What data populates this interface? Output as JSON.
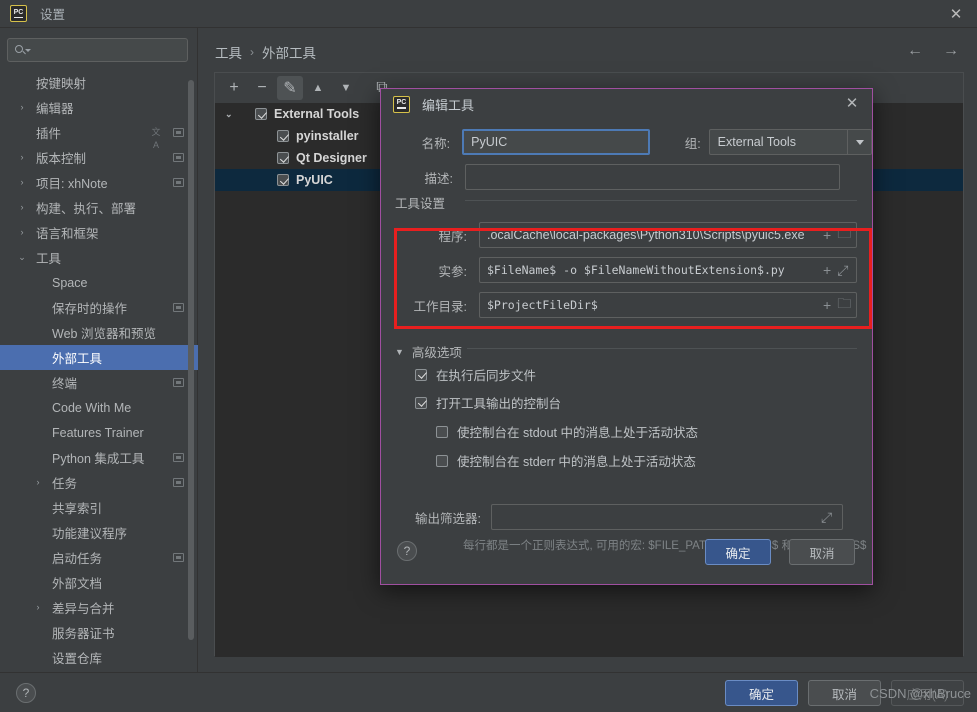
{
  "window": {
    "title": "设置",
    "logo_text": "PC",
    "close_icon": "✕"
  },
  "sidebar": {
    "search_placeholder": "",
    "items": [
      {
        "label": "按键映射",
        "indent": 36,
        "arrow": "",
        "mark": false,
        "tr": false,
        "selected": false
      },
      {
        "label": "编辑器",
        "indent": 36,
        "arrow": "›",
        "mark": false,
        "tr": false,
        "selected": false
      },
      {
        "label": "插件",
        "indent": 36,
        "arrow": "",
        "mark": true,
        "tr": true,
        "selected": false
      },
      {
        "label": "版本控制",
        "indent": 36,
        "arrow": "›",
        "mark": true,
        "tr": false,
        "selected": false
      },
      {
        "label": "项目: xhNote",
        "indent": 36,
        "arrow": "›",
        "mark": true,
        "tr": false,
        "selected": false
      },
      {
        "label": "构建、执行、部署",
        "indent": 36,
        "arrow": "›",
        "mark": false,
        "tr": false,
        "selected": false
      },
      {
        "label": "语言和框架",
        "indent": 36,
        "arrow": "›",
        "mark": false,
        "tr": false,
        "selected": false
      },
      {
        "label": "工具",
        "indent": 36,
        "arrow": "⌄",
        "mark": false,
        "tr": false,
        "selected": false
      },
      {
        "label": "Space",
        "indent": 52,
        "arrow": "",
        "mark": false,
        "tr": false,
        "selected": false
      },
      {
        "label": "保存时的操作",
        "indent": 52,
        "arrow": "",
        "mark": true,
        "tr": false,
        "selected": false
      },
      {
        "label": "Web 浏览器和预览",
        "indent": 52,
        "arrow": "",
        "mark": false,
        "tr": false,
        "selected": false
      },
      {
        "label": "外部工具",
        "indent": 52,
        "arrow": "",
        "mark": false,
        "tr": false,
        "selected": true
      },
      {
        "label": "终端",
        "indent": 52,
        "arrow": "",
        "mark": true,
        "tr": false,
        "selected": false
      },
      {
        "label": "Code With Me",
        "indent": 52,
        "arrow": "",
        "mark": false,
        "tr": false,
        "selected": false
      },
      {
        "label": "Features Trainer",
        "indent": 52,
        "arrow": "",
        "mark": false,
        "tr": false,
        "selected": false
      },
      {
        "label": "Python 集成工具",
        "indent": 52,
        "arrow": "",
        "mark": true,
        "tr": false,
        "selected": false
      },
      {
        "label": "任务",
        "indent": 52,
        "arrow": "›",
        "mark": true,
        "tr": false,
        "selected": false
      },
      {
        "label": "共享索引",
        "indent": 52,
        "arrow": "",
        "mark": false,
        "tr": false,
        "selected": false
      },
      {
        "label": "功能建议程序",
        "indent": 52,
        "arrow": "",
        "mark": false,
        "tr": false,
        "selected": false
      },
      {
        "label": "启动任务",
        "indent": 52,
        "arrow": "",
        "mark": true,
        "tr": false,
        "selected": false
      },
      {
        "label": "外部文档",
        "indent": 52,
        "arrow": "",
        "mark": false,
        "tr": false,
        "selected": false
      },
      {
        "label": "差异与合并",
        "indent": 52,
        "arrow": "›",
        "mark": false,
        "tr": false,
        "selected": false
      },
      {
        "label": "服务器证书",
        "indent": 52,
        "arrow": "",
        "mark": false,
        "tr": false,
        "selected": false
      },
      {
        "label": "设置仓库",
        "indent": 52,
        "arrow": "",
        "mark": false,
        "tr": false,
        "selected": false
      }
    ]
  },
  "main": {
    "breadcrumb": {
      "root": "工具",
      "separator": "›",
      "leaf": "外部工具"
    },
    "nav": {
      "back": "←",
      "forward": "→"
    },
    "toolbar": {
      "add": "+",
      "remove": "−",
      "edit": "✎",
      "move_up": "▲",
      "move_down": "▼",
      "copy": "⧉"
    },
    "tools": [
      {
        "label": "External Tools",
        "indent": 40,
        "chev": "⌄",
        "checked": true,
        "selected": false
      },
      {
        "label": "pyinstaller",
        "indent": 62,
        "chev": "",
        "checked": true,
        "selected": false
      },
      {
        "label": "Qt Designer",
        "indent": 62,
        "chev": "",
        "checked": true,
        "selected": false
      },
      {
        "label": "PyUIC",
        "indent": 62,
        "chev": "",
        "checked": true,
        "selected": true
      }
    ]
  },
  "dialog": {
    "title": "编辑工具",
    "logo_text": "PC",
    "close_icon": "✕",
    "name_label": "名称:",
    "name_value": "PyUIC",
    "group_label": "组:",
    "group_value": "External Tools",
    "desc_label": "描述:",
    "desc_value": "",
    "tool_settings_title": "工具设置",
    "program_label": "程序:",
    "program_value": ".ocalCache\\local-packages\\Python310\\Scripts\\pyuic5.exe",
    "arguments_label": "实参:",
    "arguments_value": "$FileName$ -o $FileNameWithoutExtension$.py",
    "workdir_label": "工作目录:",
    "workdir_value": "$ProjectFileDir$",
    "insert_macro_icon": "+",
    "browse_icon": "🗀",
    "expand_icon": "⤢",
    "advanced_title": "高级选项",
    "advanced_arrow": "▼",
    "checkboxes": [
      {
        "label": "在执行后同步文件",
        "checked": true,
        "indent": 0
      },
      {
        "label": "打开工具输出的控制台",
        "checked": true,
        "indent": 0
      },
      {
        "label": "使控制台在 stdout 中的消息上处于活动状态",
        "checked": false,
        "indent": 21
      },
      {
        "label": "使控制台在 stderr 中的消息上处于活动状态",
        "checked": false,
        "indent": 21
      }
    ],
    "output_filter_label": "输出筛选器:",
    "output_filter_value": "",
    "output_filter_hint": "每行都是一个正则表达式, 可用的宏: $FILE_PATH$、$LINES$ 和 $COLUMNS$",
    "help_icon": "?",
    "ok_label": "确定",
    "cancel_label": "取消"
  },
  "footer": {
    "help_icon": "?",
    "ok_label": "确定",
    "cancel_label": "取消",
    "apply_label": "应用(A)"
  },
  "watermark": "CSDN @xhBruce",
  "colors": {
    "window_bg": "#3c3f41",
    "list_bg": "#2b2b2b",
    "selection_blue": "#4b6eaf",
    "list_selection": "#0d293e",
    "dialog_border": "#a04fa0",
    "highlight_red": "#e81f1f",
    "primary_button": "#37568c"
  }
}
